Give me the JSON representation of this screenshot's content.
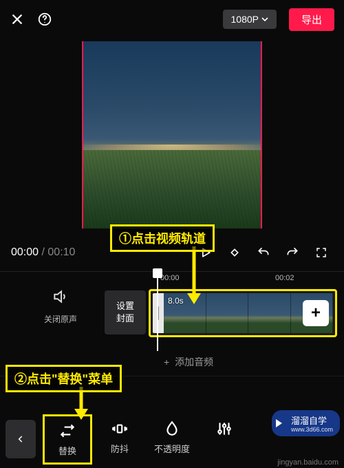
{
  "topbar": {
    "close_icon": "close-icon",
    "help_icon": "help-icon",
    "resolution_label": "1080P",
    "export_label": "导出"
  },
  "annotations": {
    "step1": "①点击视频轨道",
    "step2": "②点击\"替换\"菜单"
  },
  "time": {
    "current": "00:00",
    "total": "00:10",
    "separator": " / "
  },
  "ruler": {
    "tick1": "00:00",
    "tick2": "00:02"
  },
  "track": {
    "mute_label": "关闭原声",
    "cover_label": "设置\n封面",
    "clip_duration": "8.0s",
    "add_clip_label": "+",
    "add_audio_label": "添加音频",
    "add_audio_plus": "+"
  },
  "tools": {
    "replace": "替换",
    "stabilize": "防抖",
    "opacity": "不透明度",
    "more": ""
  },
  "watermark": {
    "brand": "溜溜自学",
    "brand_sub": "www.3d66.com",
    "source": "jingyan.baidu.com"
  }
}
